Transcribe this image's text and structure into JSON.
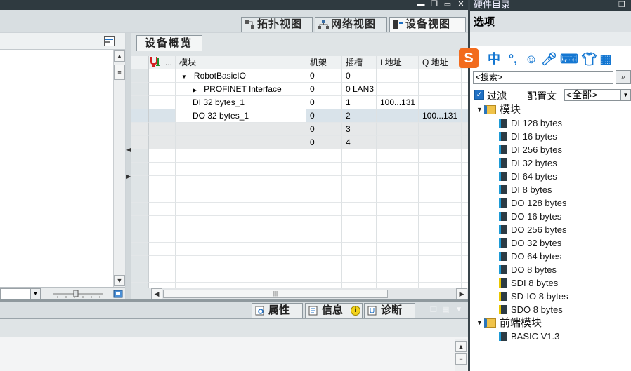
{
  "view_tabs": [
    {
      "label": "拓扑视图",
      "active": false
    },
    {
      "label": "网络视图",
      "active": false
    },
    {
      "label": "设备视图",
      "active": true
    }
  ],
  "device_overview": {
    "tab_label": "设备概览",
    "columns": [
      "...",
      "模块",
      "机架",
      "插槽",
      "I 地址",
      "Q 地址",
      "..."
    ],
    "rows": [
      {
        "module": "RobotBasicIO",
        "expander": "▼",
        "indent": 0,
        "rack": "0",
        "slot": "0",
        "i_addr": "",
        "q_addr": ""
      },
      {
        "module": "PROFINET Interface",
        "expander": "▶",
        "indent": 1,
        "rack": "0",
        "slot": "0 LAN3",
        "i_addr": "",
        "q_addr": ""
      },
      {
        "module": "DI 32 bytes_1",
        "expander": "",
        "indent": 0,
        "rack": "0",
        "slot": "1",
        "i_addr": "100...131",
        "q_addr": ""
      },
      {
        "module": "DO 32 bytes_1",
        "expander": "",
        "indent": 0,
        "rack": "0",
        "slot": "2",
        "i_addr": "",
        "q_addr": "100...131"
      },
      {
        "module": "",
        "expander": "",
        "indent": 0,
        "rack": "0",
        "slot": "3",
        "i_addr": "",
        "q_addr": ""
      },
      {
        "module": "",
        "expander": "",
        "indent": 0,
        "rack": "0",
        "slot": "4",
        "i_addr": "",
        "q_addr": ""
      }
    ],
    "selected_row_index": 3
  },
  "inspector_tabs": [
    {
      "label": "属性"
    },
    {
      "label": "信息"
    },
    {
      "label": "诊断"
    }
  ],
  "catalog": {
    "title": "硬件目录",
    "options_label": "选项",
    "ime_brand": "S",
    "ime_lang": "中",
    "search_placeholder": "<搜索>",
    "filter_label": "过滤",
    "filter_checked": true,
    "profile_label": "配置文",
    "profile_value": "<全部>",
    "folders": [
      {
        "label": "模块",
        "items": [
          {
            "label": "DI 128 bytes",
            "type": "standard"
          },
          {
            "label": "DI 16 bytes",
            "type": "standard"
          },
          {
            "label": "DI 256 bytes",
            "type": "standard"
          },
          {
            "label": "DI 32 bytes",
            "type": "standard"
          },
          {
            "label": "DI 64 bytes",
            "type": "standard"
          },
          {
            "label": "DI 8 bytes",
            "type": "standard"
          },
          {
            "label": "DO 128 bytes",
            "type": "standard"
          },
          {
            "label": "DO 16 bytes",
            "type": "standard"
          },
          {
            "label": "DO 256 bytes",
            "type": "standard"
          },
          {
            "label": "DO 32 bytes",
            "type": "standard"
          },
          {
            "label": "DO 64 bytes",
            "type": "standard"
          },
          {
            "label": "DO 8 bytes",
            "type": "standard"
          },
          {
            "label": "SDI 8 bytes",
            "type": "safety"
          },
          {
            "label": "SD-IO 8 bytes",
            "type": "safety"
          },
          {
            "label": "SDO 8 bytes",
            "type": "safety"
          }
        ]
      },
      {
        "label": "前端模块",
        "items": [
          {
            "label": "BASIC V1.3",
            "type": "standard"
          }
        ]
      }
    ]
  },
  "colors": {
    "accent": "#1f70c4",
    "safety": "#e9c600",
    "module_icon": "#2c3b44",
    "ime_orange": "#f26b1d"
  }
}
